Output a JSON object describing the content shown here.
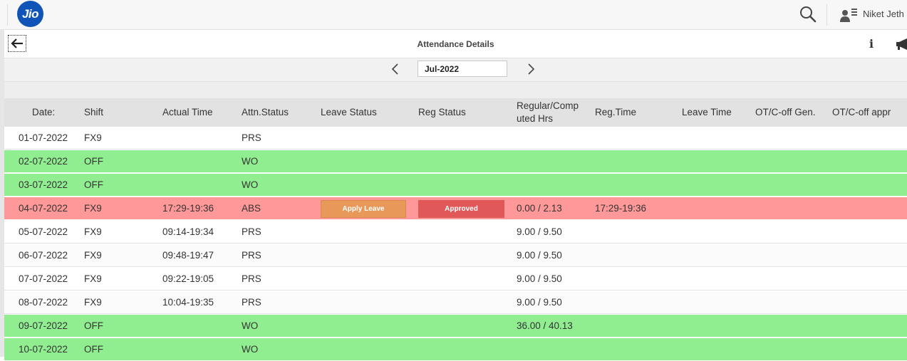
{
  "app": {
    "logo_text": "Jio",
    "user_name": "Niket Jeth"
  },
  "page": {
    "title": "Attendance Details"
  },
  "month_selector": {
    "value": "Jul-2022"
  },
  "icons": {
    "back": "back-arrow-icon",
    "search": "search-icon",
    "user": "user-list-icon",
    "info": "info-icon",
    "megaphone": "megaphone-icon",
    "prev": "chevron-left-icon",
    "next": "chevron-right-icon"
  },
  "info_glyph": "i",
  "colors": {
    "present_row": "#ffffff",
    "weekly_off_row": "#90ee90",
    "absent_row": "#ff9999",
    "apply_leave_button": "#e8995a",
    "approved_button": "#e05858",
    "brand": "#1154b7"
  },
  "table": {
    "headers": {
      "date": "Date:",
      "shift": "Shift",
      "actual_time": "Actual Time",
      "attn_status": "Attn.Status",
      "leave_status": "Leave Status",
      "reg_status": "Reg Status",
      "hours_line1": "Regular/Comp",
      "hours_line2": "uted Hrs",
      "reg_time": "Reg.Time",
      "leave_time": "Leave Time",
      "ot_gen": "OT/C-off Gen.",
      "ot_appr": "OT/C-off appr"
    },
    "rows": [
      {
        "date": "01-07-2022",
        "shift": "FX9",
        "actual_time": "",
        "attn_status": "PRS",
        "hours": "",
        "reg_time": ""
      },
      {
        "date": "02-07-2022",
        "shift": "OFF",
        "actual_time": "",
        "attn_status": "WO",
        "hours": "",
        "reg_time": ""
      },
      {
        "date": "03-07-2022",
        "shift": "OFF",
        "actual_time": "",
        "attn_status": "WO",
        "hours": "",
        "reg_time": ""
      },
      {
        "date": "04-07-2022",
        "shift": "FX9",
        "actual_time": "17:29-19:36",
        "attn_status": "ABS",
        "leave_button": "Apply Leave",
        "reg_button": "Approved",
        "hours": "0.00 / 2.13",
        "reg_time": "17:29-19:36"
      },
      {
        "date": "05-07-2022",
        "shift": "FX9",
        "actual_time": "09:14-19:34",
        "attn_status": "PRS",
        "hours": "9.00 / 9.50",
        "reg_time": ""
      },
      {
        "date": "06-07-2022",
        "shift": "FX9",
        "actual_time": "09:48-19:47",
        "attn_status": "PRS",
        "hours": "9.00 / 9.50",
        "reg_time": ""
      },
      {
        "date": "07-07-2022",
        "shift": "FX9",
        "actual_time": "09:22-19:05",
        "attn_status": "PRS",
        "hours": "9.00 / 9.50",
        "reg_time": ""
      },
      {
        "date": "08-07-2022",
        "shift": "FX9",
        "actual_time": "10:04-19:35",
        "attn_status": "PRS",
        "hours": "9.00 / 9.50",
        "reg_time": ""
      },
      {
        "date": "09-07-2022",
        "shift": "OFF",
        "actual_time": "",
        "attn_status": "WO",
        "hours": "36.00 / 40.13",
        "reg_time": ""
      },
      {
        "date": "10-07-2022",
        "shift": "OFF",
        "actual_time": "",
        "attn_status": "WO",
        "hours": "",
        "reg_time": ""
      }
    ]
  }
}
